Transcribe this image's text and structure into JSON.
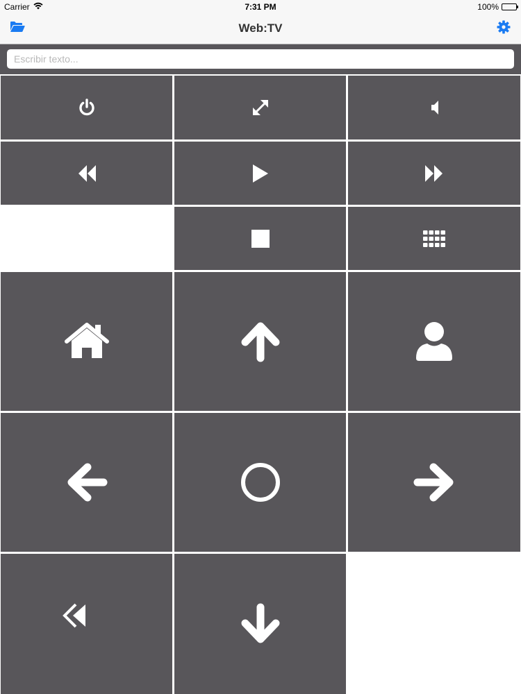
{
  "status_bar": {
    "carrier": "Carrier",
    "time": "7:31 PM",
    "battery": "100%",
    "battery_level": 1.0
  },
  "nav": {
    "title": "Web:TV",
    "left_icon": "folder-open-icon",
    "right_icon": "gear-icon"
  },
  "search": {
    "placeholder": "Escribir texto...",
    "value": ""
  },
  "colors": {
    "accent": "#1a7bf2",
    "button_bg": "#58565a",
    "icon": "#ffffff",
    "bar_bg": "#f7f7f7"
  },
  "buttons": [
    {
      "id": "power",
      "icon": "power-icon"
    },
    {
      "id": "fullscreen",
      "icon": "expand-icon"
    },
    {
      "id": "volume",
      "icon": "volume-icon"
    },
    {
      "id": "rewind",
      "icon": "rewind-icon"
    },
    {
      "id": "play",
      "icon": "play-icon"
    },
    {
      "id": "fast-forward",
      "icon": "fast-forward-icon"
    },
    {
      "id": "stop",
      "icon": "stop-icon"
    },
    {
      "id": "menu-grid",
      "icon": "grid-icon"
    },
    {
      "id": "home",
      "icon": "home-icon"
    },
    {
      "id": "up",
      "icon": "arrow-up-icon"
    },
    {
      "id": "user",
      "icon": "user-icon"
    },
    {
      "id": "left",
      "icon": "arrow-left-icon"
    },
    {
      "id": "ok",
      "icon": "circle-icon"
    },
    {
      "id": "right",
      "icon": "arrow-right-icon"
    },
    {
      "id": "back",
      "icon": "reply-all-icon"
    },
    {
      "id": "down",
      "icon": "arrow-down-icon"
    }
  ]
}
